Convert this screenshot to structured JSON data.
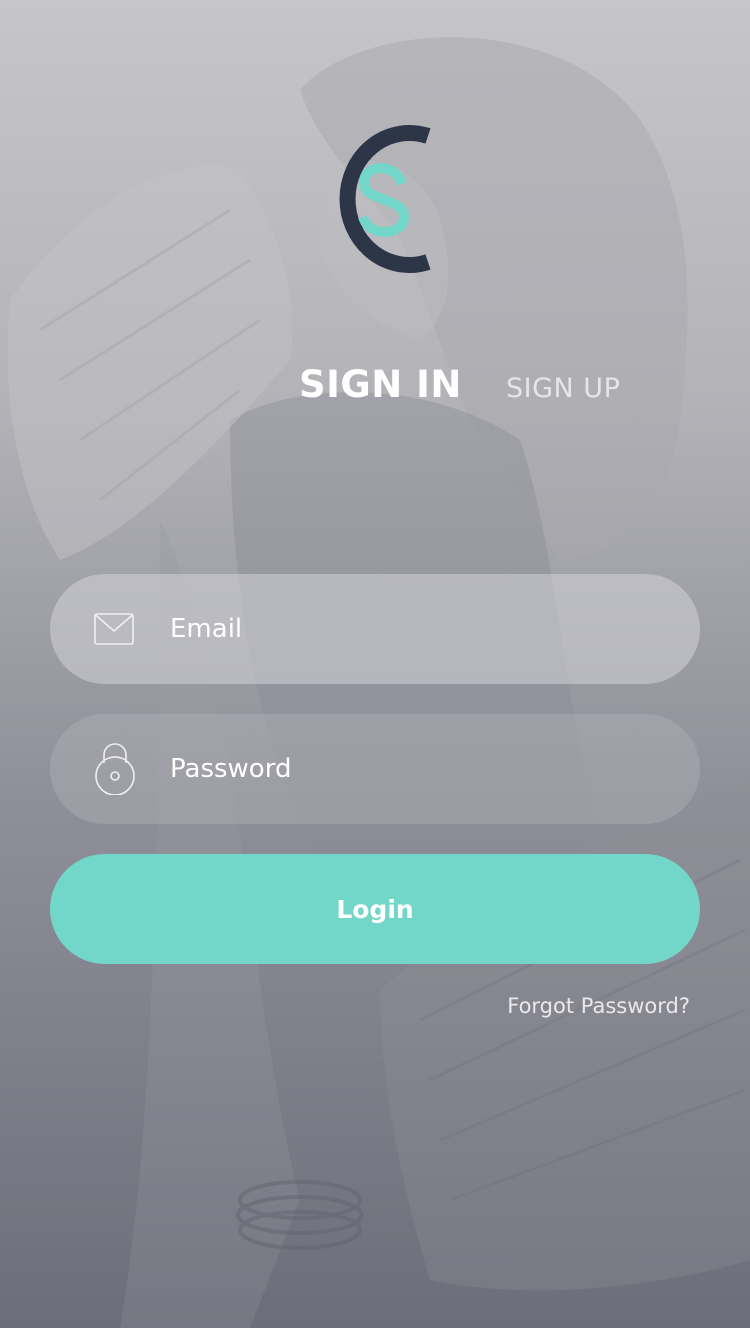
{
  "logo": {
    "letters": "CS",
    "outer_color": "#2d3647",
    "inner_color": "#72d6c9"
  },
  "tabs": {
    "sign_in": "SIGN IN",
    "sign_up": "SIGN UP",
    "active": "sign_in"
  },
  "form": {
    "email": {
      "placeholder": "Email",
      "value": "",
      "icon": "envelope-icon"
    },
    "password": {
      "placeholder": "Password",
      "value": "",
      "icon": "padlock-icon"
    },
    "login_label": "Login",
    "forgot_label": "Forgot Password?"
  },
  "colors": {
    "accent": "#72d6c9",
    "text": "#ffffff"
  }
}
